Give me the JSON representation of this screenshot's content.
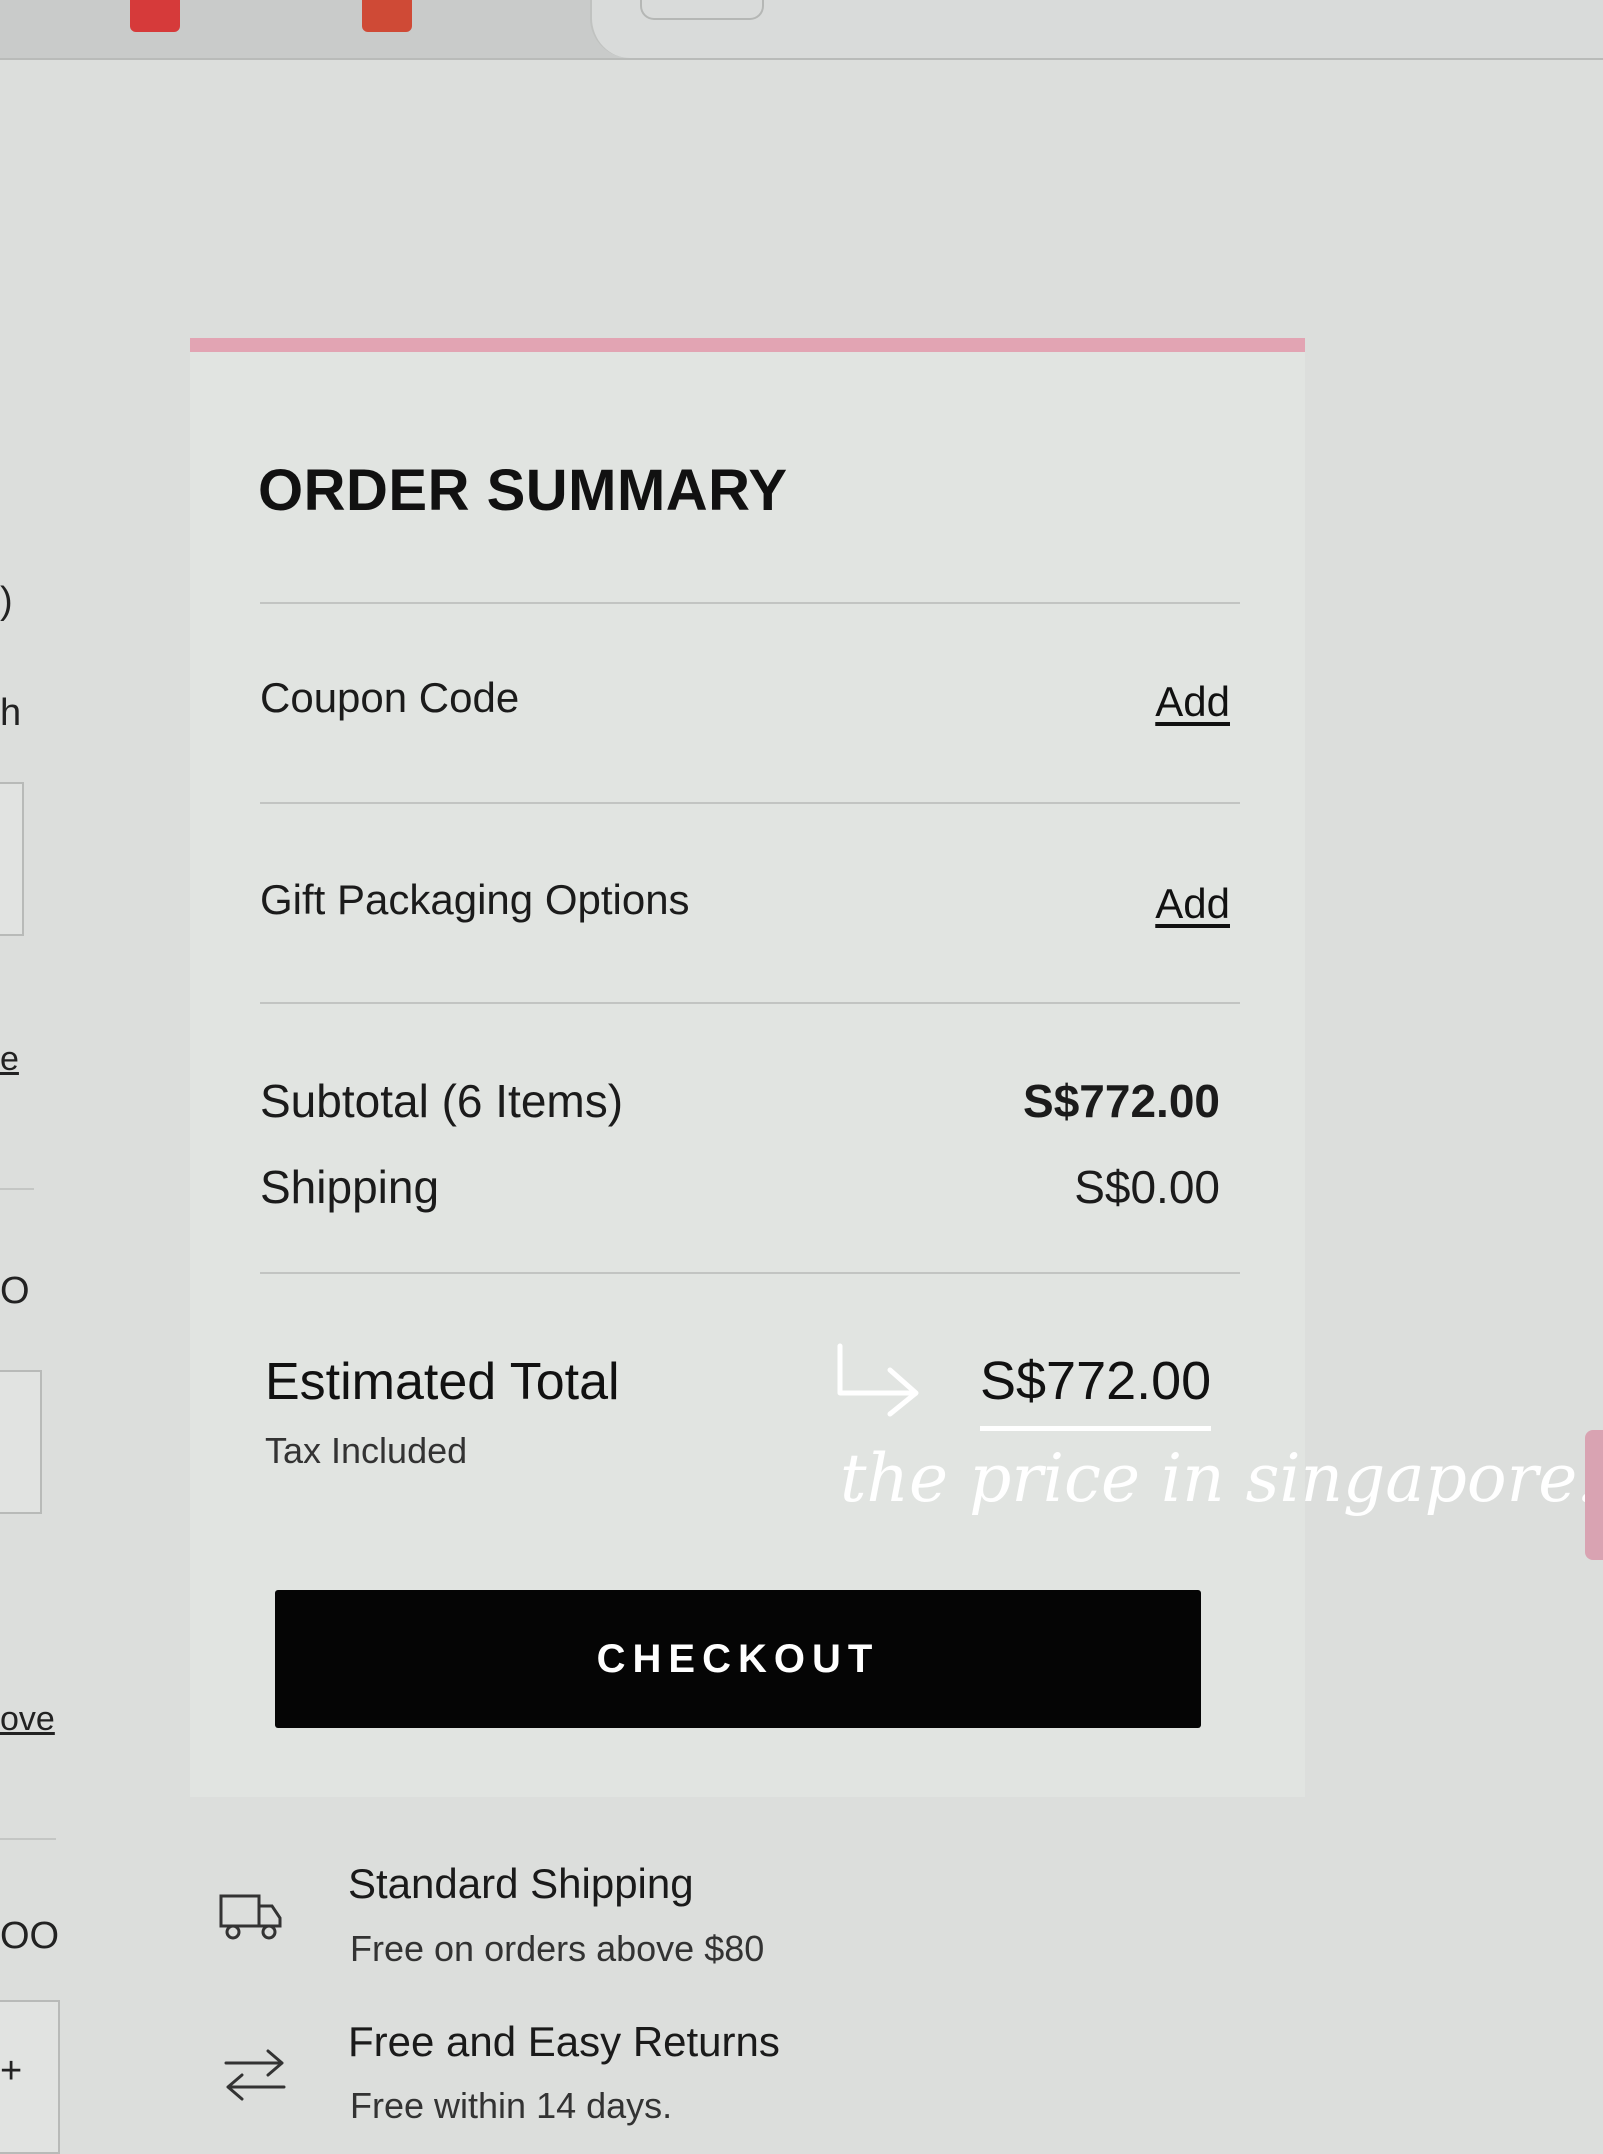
{
  "order_summary": {
    "title": "ORDER SUMMARY",
    "coupon": {
      "label": "Coupon Code",
      "action": "Add"
    },
    "gift": {
      "label": "Gift Packaging Options",
      "action": "Add"
    },
    "subtotal": {
      "label": "Subtotal (6 Items)",
      "value": "S$772.00"
    },
    "shipping": {
      "label": "Shipping",
      "value": "S$0.00"
    },
    "total": {
      "label": "Estimated Total",
      "sub": "Tax Included",
      "value": "S$772.00"
    },
    "checkout_label": "CHECKOUT"
  },
  "annotation": {
    "note": "the price in singapore!",
    "color": "#ffffff"
  },
  "perks": [
    {
      "icon": "truck-icon",
      "title": "Standard Shipping",
      "sub": "Free on orders above $80"
    },
    {
      "icon": "exchange-arrows-icon",
      "title": "Free and Easy Returns",
      "sub": "Free within 14 days."
    }
  ],
  "left_column": {
    "fragments": [
      "h",
      "e",
      "ove",
      "O",
      "OO"
    ]
  },
  "colors": {
    "accent_bar": "#e2a4b3",
    "button_bg": "#050505",
    "card_bg": "#e1e4e1"
  }
}
